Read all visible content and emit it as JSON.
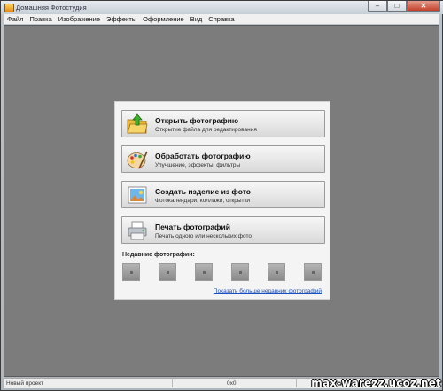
{
  "window": {
    "title": "Домашняя Фотостудия",
    "controls": {
      "minimize": "–",
      "maximize": "□",
      "close": "✕"
    }
  },
  "menu": [
    "Файл",
    "Правка",
    "Изображение",
    "Эффекты",
    "Оформление",
    "Вид",
    "Справка"
  ],
  "actions": [
    {
      "title": "Открыть фотографию",
      "subtitle": "Открытие файла для редактирования",
      "icon": "folder-open-icon"
    },
    {
      "title": "Обработать фотографию",
      "subtitle": "Улучшение, эффекты, фильтры",
      "icon": "palette-icon"
    },
    {
      "title": "Создать изделие из фото",
      "subtitle": "Фотокалендари, коллажи, открытки",
      "icon": "photo-frame-icon"
    },
    {
      "title": "Печать фотографий",
      "subtitle": "Печать одного или нескольких фото",
      "icon": "printer-icon"
    }
  ],
  "recent": {
    "label": "Недавние фотографии:",
    "more_link": "Показать больше недавних фотографий"
  },
  "status": {
    "project": "Новый проект",
    "size": "0x0"
  },
  "watermark": "max-warezz.ucoz.net"
}
